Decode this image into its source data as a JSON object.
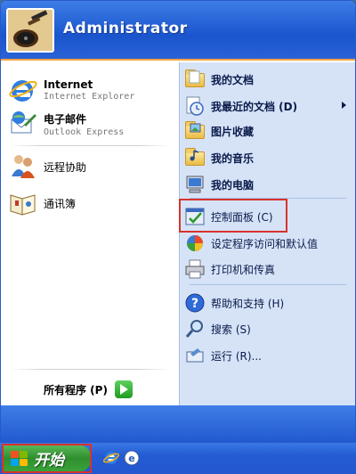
{
  "user": {
    "name": "Administrator",
    "avatar_icon": "guitar-avatar"
  },
  "pinned": [
    {
      "title": "Internet",
      "subtitle": "Internet Explorer",
      "icon": "internet-explorer-icon"
    },
    {
      "title": "电子邮件",
      "subtitle": "Outlook Express",
      "icon": "outlook-express-icon"
    }
  ],
  "recent": [
    {
      "label": "远程协助",
      "icon": "remote-assistance-icon"
    },
    {
      "label": "通讯簿",
      "icon": "address-book-icon"
    }
  ],
  "all_programs": {
    "label": "所有程序 (P)"
  },
  "places": [
    {
      "label": "我的文档",
      "bold": true,
      "icon": "my-documents-icon"
    },
    {
      "label": "我最近的文档 (D)",
      "bold": true,
      "icon": "recent-documents-icon",
      "submenu": true
    },
    {
      "label": "图片收藏",
      "bold": true,
      "icon": "my-pictures-icon"
    },
    {
      "label": "我的音乐",
      "bold": true,
      "icon": "my-music-icon"
    },
    {
      "label": "我的电脑",
      "bold": true,
      "icon": "my-computer-icon"
    }
  ],
  "system": [
    {
      "label": "控制面板 (C)",
      "icon": "control-panel-icon",
      "highlighted": true
    },
    {
      "label": "设定程序访问和默认值",
      "icon": "program-access-defaults-icon"
    },
    {
      "label": "打印机和传真",
      "icon": "printers-faxes-icon"
    }
  ],
  "help": [
    {
      "label": "帮助和支持 (H)",
      "icon": "help-support-icon"
    },
    {
      "label": "搜索 (S)",
      "icon": "search-icon"
    },
    {
      "label": "运行 (R)...",
      "icon": "run-icon"
    }
  ],
  "taskbar": {
    "start_label": "开始",
    "start_highlighted": true,
    "quicklaunch": [
      "internet-explorer-icon",
      "outlook-express-icon"
    ]
  },
  "colors": {
    "highlight_border": "#d9322d",
    "header_blue": "#1a55cd",
    "right_panel": "#d6e3f7",
    "start_green": "#3aa33a"
  }
}
